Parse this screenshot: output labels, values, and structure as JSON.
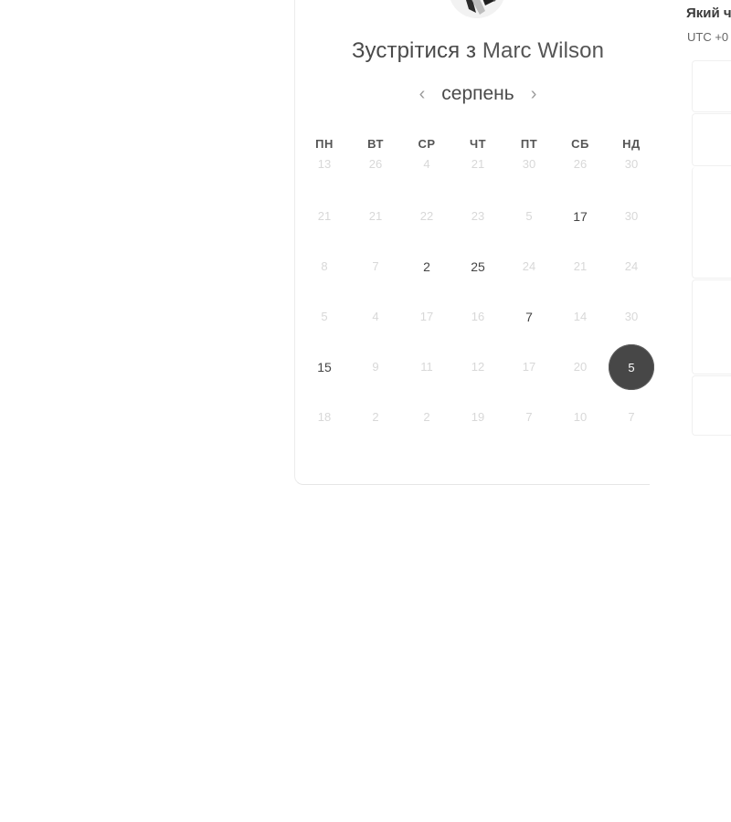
{
  "booking": {
    "title_prefix": "Зустрітися з",
    "host_name": "Marc Wilson",
    "month": "серпень",
    "prev_icon": "chevron-left-icon",
    "next_icon": "chevron-right-icon",
    "weekdays": [
      "ПН",
      "ВТ",
      "СР",
      "ЧТ",
      "ПТ",
      "СБ",
      "НД"
    ],
    "weeks": [
      [
        {
          "n": "13"
        },
        {
          "n": "26"
        },
        {
          "n": "4"
        },
        {
          "n": "21"
        },
        {
          "n": "30"
        },
        {
          "n": "26"
        },
        {
          "n": "30"
        }
      ],
      [
        {
          "n": "21"
        },
        {
          "n": "21"
        },
        {
          "n": "22"
        },
        {
          "n": "23"
        },
        {
          "n": "5"
        },
        {
          "n": "17",
          "available": true
        },
        {
          "n": "30"
        }
      ],
      [
        {
          "n": "8"
        },
        {
          "n": "7"
        },
        {
          "n": "2",
          "available": true
        },
        {
          "n": "25",
          "available": true
        },
        {
          "n": "24"
        },
        {
          "n": "21"
        },
        {
          "n": "24"
        }
      ],
      [
        {
          "n": "5"
        },
        {
          "n": "4"
        },
        {
          "n": "17"
        },
        {
          "n": "16"
        },
        {
          "n": "7",
          "available": true
        },
        {
          "n": "14"
        },
        {
          "n": "30"
        }
      ],
      [
        {
          "n": "15",
          "available": true
        },
        {
          "n": "9"
        },
        {
          "n": "11"
        },
        {
          "n": "12"
        },
        {
          "n": "17"
        },
        {
          "n": "20"
        },
        {
          "n": "5",
          "available": true,
          "selected": true
        }
      ],
      [
        {
          "n": "18"
        },
        {
          "n": "2"
        },
        {
          "n": "2"
        },
        {
          "n": "19"
        },
        {
          "n": "7"
        },
        {
          "n": "10"
        },
        {
          "n": "7"
        }
      ]
    ],
    "selected_color": "#474747"
  },
  "side_panel": {
    "title": "Який ч",
    "timezone": "UTC +0"
  }
}
